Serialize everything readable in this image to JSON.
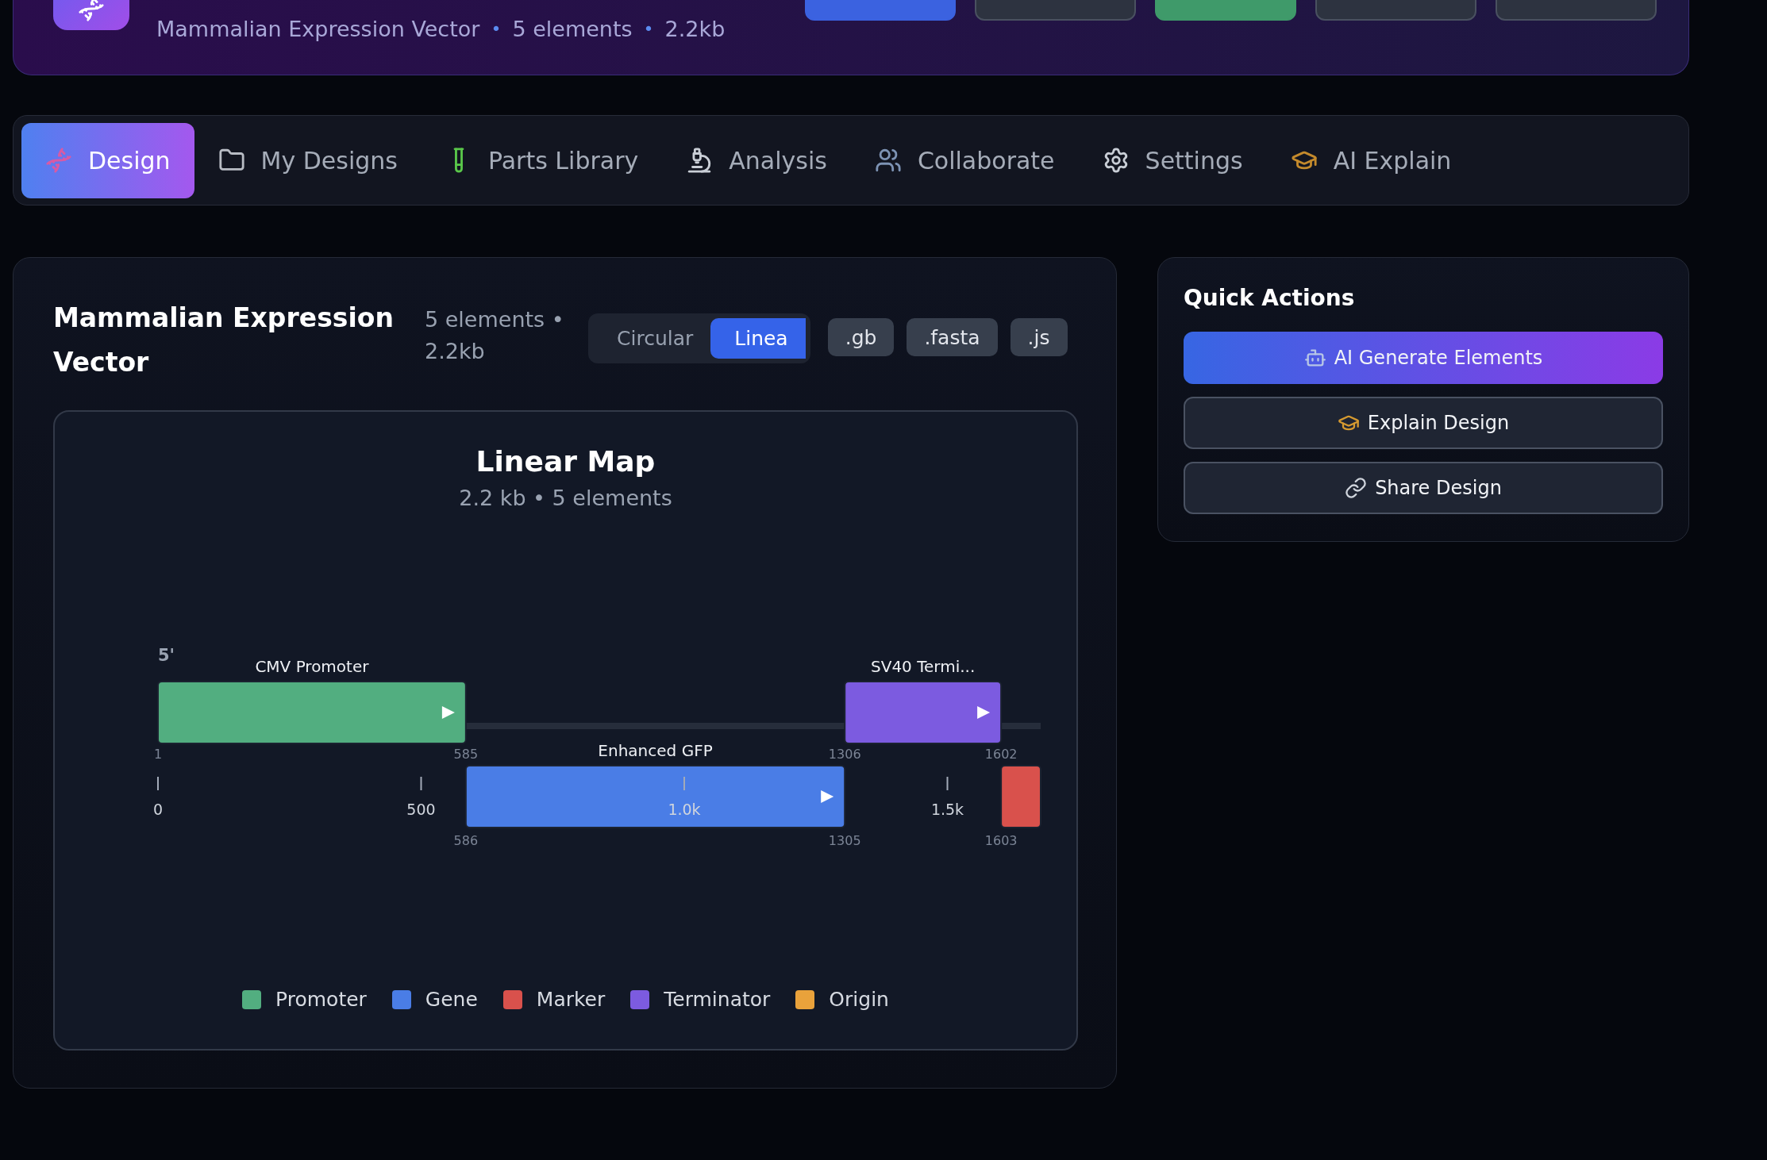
{
  "header": {
    "subtitle": [
      {
        "kind": "text",
        "text": "Mammalian Expression Vector"
      },
      {
        "kind": "bullet",
        "text": "•"
      },
      {
        "kind": "text",
        "text": "5 elements"
      },
      {
        "kind": "bullet",
        "text": "•"
      },
      {
        "kind": "text",
        "text": "2.2kb"
      }
    ],
    "buttons": [
      {
        "kind": "primary"
      },
      {
        "kind": "secondary"
      },
      {
        "kind": "success"
      },
      {
        "kind": "secondary"
      },
      {
        "kind": "secondary"
      }
    ]
  },
  "tabs": [
    {
      "label": "Design",
      "selected": true
    },
    {
      "label": "My Designs",
      "selected": false
    },
    {
      "label": "Parts Library",
      "selected": false
    },
    {
      "label": "Analysis",
      "selected": false
    },
    {
      "label": "Collaborate",
      "selected": false
    },
    {
      "label": "Settings",
      "selected": false
    },
    {
      "label": "AI Explain",
      "selected": false
    }
  ],
  "design": {
    "title": "Mammalian Expression Vector",
    "meta": "5 elements • 2.2kb",
    "view_toggle": [
      {
        "label": "Circular",
        "selected": false
      },
      {
        "label": "Linea",
        "selected": true
      }
    ],
    "exports": [
      ".gb",
      ".fasta",
      ".js"
    ],
    "map": {
      "title": "Linear Map",
      "subtitle": "2.2 kb • 5 elements",
      "strand_label": "5'",
      "elements": [
        {
          "color": "#52ae80",
          "label": "CMV Promoter",
          "start": "1",
          "end": "585"
        },
        {
          "color": "#4a7de6",
          "label": "Enhanced GFP",
          "start": "586",
          "end": "1305"
        },
        {
          "color": "#7c5be0",
          "label": "SV40 Termi...",
          "start": "1306",
          "end": "1602"
        },
        {
          "color": "#d9514c",
          "start": "1603"
        }
      ],
      "axis": [
        "0",
        "500",
        "1.0k",
        "1.5k"
      ]
    },
    "legend": [
      {
        "label": "Promoter",
        "color": "#52ae80"
      },
      {
        "label": "Gene",
        "color": "#4a7de6"
      },
      {
        "label": "Marker",
        "color": "#d9514c"
      },
      {
        "label": "Terminator",
        "color": "#7c5be0"
      },
      {
        "label": "Origin",
        "color": "#e9a23b"
      }
    ]
  },
  "quick_actions": {
    "title": "Quick Actions",
    "buttons": [
      {
        "kind": "primary",
        "label": "AI Generate Elements"
      },
      {
        "kind": "secondary",
        "label": "Explain Design"
      },
      {
        "kind": "secondary",
        "label": "Share Design"
      }
    ]
  }
}
